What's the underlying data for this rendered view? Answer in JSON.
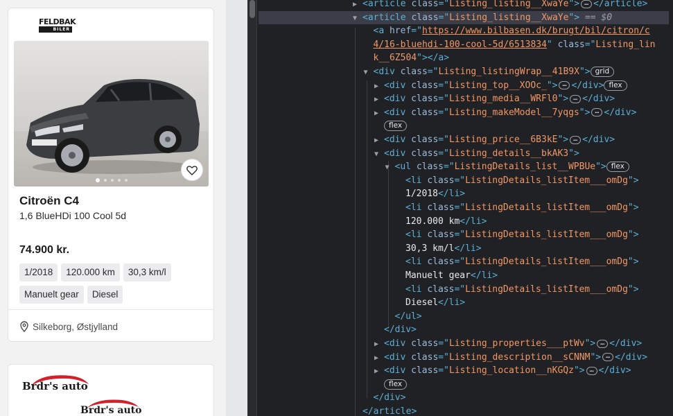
{
  "listing": {
    "dealer_logo": {
      "line1": "FELDBAK",
      "line2": "BILER"
    },
    "make": "Citroën C4",
    "model": "1,6 BlueHDi 100 Cool 5d",
    "price": "74.900 kr.",
    "details": [
      "1/2018",
      "120.000 km",
      "30,3 km/l",
      "Manuelt gear",
      "Diesel"
    ],
    "location": "Silkeborg, Østjylland",
    "image_dots": 5,
    "active_dot": 0
  },
  "next_listing": {
    "dealer_logo_text": "Brdr's auto"
  },
  "devtools": {
    "selected_suffix": "== $0",
    "lines": [
      {
        "indent": 0,
        "tri": "▶",
        "parts": [
          [
            "tag",
            "<article "
          ],
          [
            "attr",
            "class"
          ],
          [
            "tag",
            "=\""
          ],
          [
            "val",
            "Listing_listing__XwaYe"
          ],
          [
            "tag",
            "\">"
          ],
          [
            "ell",
            "…"
          ],
          [
            "tag",
            "</article>"
          ]
        ]
      },
      {
        "indent": 0,
        "tri": "▼",
        "selected": true,
        "parts": [
          [
            "tag",
            "<article "
          ],
          [
            "attr",
            "class"
          ],
          [
            "tag",
            "=\""
          ],
          [
            "val",
            "Listing_listing__XwaYe"
          ],
          [
            "tag",
            "\">"
          ],
          [
            "eq",
            " == $0"
          ]
        ]
      },
      {
        "indent": 1,
        "tri": "",
        "parts": [
          [
            "tag",
            "<a "
          ],
          [
            "attr",
            "href"
          ],
          [
            "tag",
            "=\""
          ],
          [
            "link",
            "https://www.bilbasen.dk/brugt/bil/citron/c"
          ]
        ]
      },
      {
        "indent": 1,
        "tri": "",
        "parts": [
          [
            "link",
            "4/16-bluehdi-100-cool-5d/6513834"
          ],
          [
            "tag",
            "\" "
          ],
          [
            "attr",
            "class"
          ],
          [
            "tag",
            "=\""
          ],
          [
            "val",
            "Listing_lin"
          ]
        ]
      },
      {
        "indent": 1,
        "tri": "",
        "parts": [
          [
            "val",
            "k__6Z504"
          ],
          [
            "tag",
            "\"></a>"
          ]
        ]
      },
      {
        "indent": 1,
        "tri": "▼",
        "parts": [
          [
            "tag",
            "<div "
          ],
          [
            "attr",
            "class"
          ],
          [
            "tag",
            "=\""
          ],
          [
            "val",
            "Listing_listingWrap__41B9X"
          ],
          [
            "tag",
            "\">"
          ],
          [
            "badge",
            "grid"
          ]
        ]
      },
      {
        "indent": 2,
        "tri": "▶",
        "parts": [
          [
            "tag",
            "<div "
          ],
          [
            "attr",
            "class"
          ],
          [
            "tag",
            "=\""
          ],
          [
            "val",
            "Listing_top__XOOc_"
          ],
          [
            "tag",
            "\">"
          ],
          [
            "ell",
            "…"
          ],
          [
            "tag",
            "</div>"
          ],
          [
            "badge",
            "flex"
          ]
        ]
      },
      {
        "indent": 2,
        "tri": "▶",
        "parts": [
          [
            "tag",
            "<div "
          ],
          [
            "attr",
            "class"
          ],
          [
            "tag",
            "=\""
          ],
          [
            "val",
            "Listing_media__WRFl0"
          ],
          [
            "tag",
            "\">"
          ],
          [
            "ell",
            "…"
          ],
          [
            "tag",
            "</div>"
          ]
        ]
      },
      {
        "indent": 2,
        "tri": "▶",
        "parts": [
          [
            "tag",
            "<div "
          ],
          [
            "attr",
            "class"
          ],
          [
            "tag",
            "=\""
          ],
          [
            "val",
            "Listing_makeModel__7yqgs"
          ],
          [
            "tag",
            "\">"
          ],
          [
            "ell",
            "…"
          ],
          [
            "tag",
            "</div>"
          ]
        ]
      },
      {
        "indent": 2,
        "tri": "",
        "parts": [
          [
            "badge",
            "flex"
          ]
        ]
      },
      {
        "indent": 2,
        "tri": "▶",
        "parts": [
          [
            "tag",
            "<div "
          ],
          [
            "attr",
            "class"
          ],
          [
            "tag",
            "=\""
          ],
          [
            "val",
            "Listing_price__6B3kE"
          ],
          [
            "tag",
            "\">"
          ],
          [
            "ell",
            "…"
          ],
          [
            "tag",
            "</div>"
          ]
        ]
      },
      {
        "indent": 2,
        "tri": "▼",
        "parts": [
          [
            "tag",
            "<div "
          ],
          [
            "attr",
            "class"
          ],
          [
            "tag",
            "=\""
          ],
          [
            "val",
            "Listing_details__bkAK3"
          ],
          [
            "tag",
            "\">"
          ]
        ]
      },
      {
        "indent": 3,
        "tri": "▼",
        "parts": [
          [
            "tag",
            "<ul "
          ],
          [
            "attr",
            "class"
          ],
          [
            "tag",
            "=\""
          ],
          [
            "val",
            "ListingDetails_list__WPBUe"
          ],
          [
            "tag",
            "\">"
          ],
          [
            "badge",
            "flex"
          ]
        ]
      },
      {
        "indent": 4,
        "tri": "",
        "parts": [
          [
            "tag",
            "<li "
          ],
          [
            "attr",
            "class"
          ],
          [
            "tag",
            "=\""
          ],
          [
            "val",
            "ListingDetails_listItem___omDg"
          ],
          [
            "tag",
            "\">"
          ]
        ]
      },
      {
        "indent": 4,
        "tri": "",
        "parts": [
          [
            "txt",
            "1/2018"
          ],
          [
            "tag",
            "</li>"
          ]
        ]
      },
      {
        "indent": 4,
        "tri": "",
        "parts": [
          [
            "tag",
            "<li "
          ],
          [
            "attr",
            "class"
          ],
          [
            "tag",
            "=\""
          ],
          [
            "val",
            "ListingDetails_listItem___omDg"
          ],
          [
            "tag",
            "\">"
          ]
        ]
      },
      {
        "indent": 4,
        "tri": "",
        "parts": [
          [
            "txt",
            "120.000 km"
          ],
          [
            "tag",
            "</li>"
          ]
        ]
      },
      {
        "indent": 4,
        "tri": "",
        "parts": [
          [
            "tag",
            "<li "
          ],
          [
            "attr",
            "class"
          ],
          [
            "tag",
            "=\""
          ],
          [
            "val",
            "ListingDetails_listItem___omDg"
          ],
          [
            "tag",
            "\">"
          ]
        ]
      },
      {
        "indent": 4,
        "tri": "",
        "parts": [
          [
            "txt",
            "30,3 km/l"
          ],
          [
            "tag",
            "</li>"
          ]
        ]
      },
      {
        "indent": 4,
        "tri": "",
        "parts": [
          [
            "tag",
            "<li "
          ],
          [
            "attr",
            "class"
          ],
          [
            "tag",
            "=\""
          ],
          [
            "val",
            "ListingDetails_listItem___omDg"
          ],
          [
            "tag",
            "\">"
          ]
        ]
      },
      {
        "indent": 4,
        "tri": "",
        "parts": [
          [
            "txt",
            "Manuelt gear"
          ],
          [
            "tag",
            "</li>"
          ]
        ]
      },
      {
        "indent": 4,
        "tri": "",
        "parts": [
          [
            "tag",
            "<li "
          ],
          [
            "attr",
            "class"
          ],
          [
            "tag",
            "=\""
          ],
          [
            "val",
            "ListingDetails_listItem___omDg"
          ],
          [
            "tag",
            "\">"
          ]
        ]
      },
      {
        "indent": 4,
        "tri": "",
        "parts": [
          [
            "txt",
            "Diesel"
          ],
          [
            "tag",
            "</li>"
          ]
        ]
      },
      {
        "indent": 3,
        "tri": "",
        "parts": [
          [
            "tag",
            "</ul>"
          ]
        ]
      },
      {
        "indent": 2,
        "tri": "",
        "parts": [
          [
            "tag",
            "</div>"
          ]
        ]
      },
      {
        "indent": 2,
        "tri": "▶",
        "parts": [
          [
            "tag",
            "<div "
          ],
          [
            "attr",
            "class"
          ],
          [
            "tag",
            "=\""
          ],
          [
            "val",
            "Listing_properties___ptWv"
          ],
          [
            "tag",
            "\">"
          ],
          [
            "ell",
            "…"
          ],
          [
            "tag",
            "</div>"
          ]
        ]
      },
      {
        "indent": 2,
        "tri": "▶",
        "parts": [
          [
            "tag",
            "<div "
          ],
          [
            "attr",
            "class"
          ],
          [
            "tag",
            "=\""
          ],
          [
            "val",
            "Listing_description__sCNNM"
          ],
          [
            "tag",
            "\">"
          ],
          [
            "ell",
            "…"
          ],
          [
            "tag",
            "</div>"
          ]
        ]
      },
      {
        "indent": 2,
        "tri": "▶",
        "parts": [
          [
            "tag",
            "<div "
          ],
          [
            "attr",
            "class"
          ],
          [
            "tag",
            "=\""
          ],
          [
            "val",
            "Listing_location__nKGQz"
          ],
          [
            "tag",
            "\">"
          ],
          [
            "ell",
            "…"
          ],
          [
            "tag",
            "</div>"
          ]
        ]
      },
      {
        "indent": 2,
        "tri": "",
        "parts": [
          [
            "badge",
            "flex"
          ]
        ]
      },
      {
        "indent": 1,
        "tri": "",
        "parts": [
          [
            "tag",
            "</div>"
          ]
        ]
      },
      {
        "indent": 0,
        "tri": "",
        "parts": [
          [
            "tag",
            "</article>"
          ]
        ]
      }
    ]
  },
  "colors": {
    "tag": "#5db0d7",
    "attr": "#9bbbdc",
    "value": "#f29766",
    "devtools_bg": "#202124",
    "selection_bg": "#3b3e48",
    "page_bg": "#f2f2f3",
    "chip_bg": "#ececee"
  },
  "icons": {
    "favorite": "heart-icon",
    "location": "map-pin-icon",
    "expand": "triangle-right-icon",
    "collapse": "triangle-down-icon",
    "more": "ellipsis-icon"
  }
}
